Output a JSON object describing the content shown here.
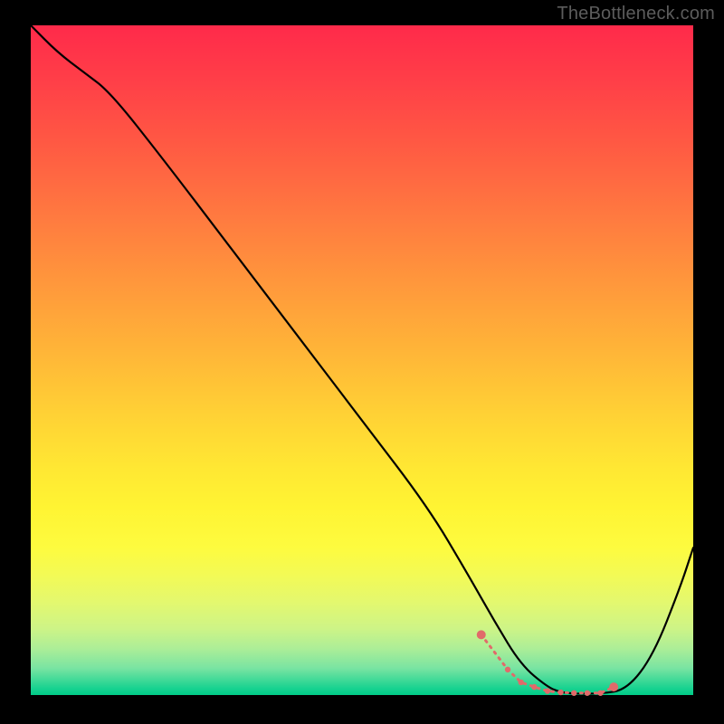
{
  "watermark": "TheBottleneck.com",
  "chart_data": {
    "type": "line",
    "title": "",
    "xlabel": "",
    "ylabel": "",
    "xlim": [
      0,
      100
    ],
    "ylim": [
      0,
      100
    ],
    "series": [
      {
        "name": "bottleneck-curve",
        "x": [
          0,
          4,
          8,
          12,
          20,
          30,
          40,
          50,
          60,
          66,
          70,
          74,
          78,
          80,
          82,
          86,
          90,
          94,
          98,
          100
        ],
        "values": [
          100,
          96,
          93,
          90,
          80,
          67,
          54,
          41,
          28,
          18,
          11,
          4.5,
          1.2,
          0.4,
          0.2,
          0.2,
          0.8,
          6,
          16,
          22
        ]
      }
    ],
    "markers": {
      "name": "optimal-range",
      "indices_x": [
        68,
        72,
        74,
        76,
        78,
        80,
        82,
        84,
        86,
        88
      ],
      "indices_y": [
        9,
        3.8,
        1.9,
        1.2,
        0.6,
        0.4,
        0.3,
        0.3,
        0.3,
        1.2
      ]
    },
    "gradient_stops": [
      {
        "pos": 0,
        "color": "#ff2a4a"
      },
      {
        "pos": 50,
        "color": "#ffc236"
      },
      {
        "pos": 80,
        "color": "#fff833"
      },
      {
        "pos": 100,
        "color": "#00cc88"
      }
    ]
  }
}
